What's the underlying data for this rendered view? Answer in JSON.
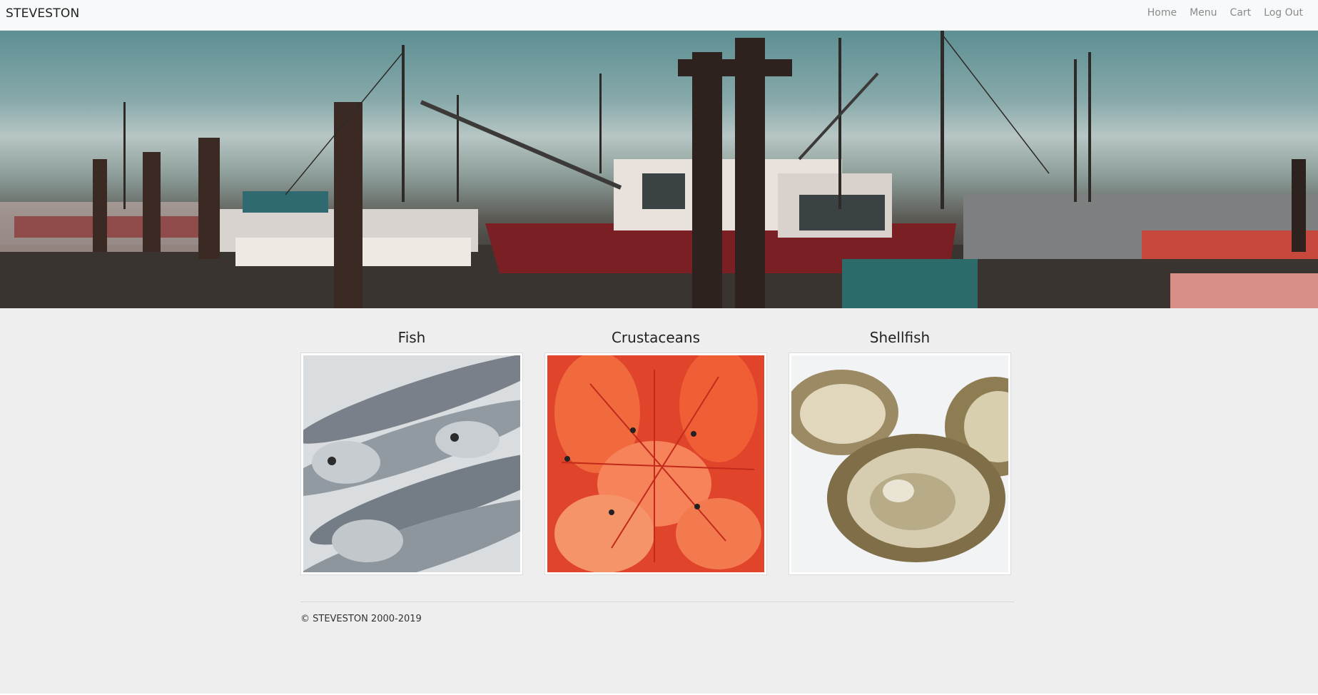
{
  "navbar": {
    "brand": "STEVESTON",
    "links": [
      "Home",
      "Menu",
      "Cart",
      "Log Out"
    ]
  },
  "categories": [
    {
      "title": "Fish"
    },
    {
      "title": "Crustaceans"
    },
    {
      "title": "Shellfish"
    }
  ],
  "footer": {
    "copyright": "© STEVESTON 2000-2019"
  }
}
